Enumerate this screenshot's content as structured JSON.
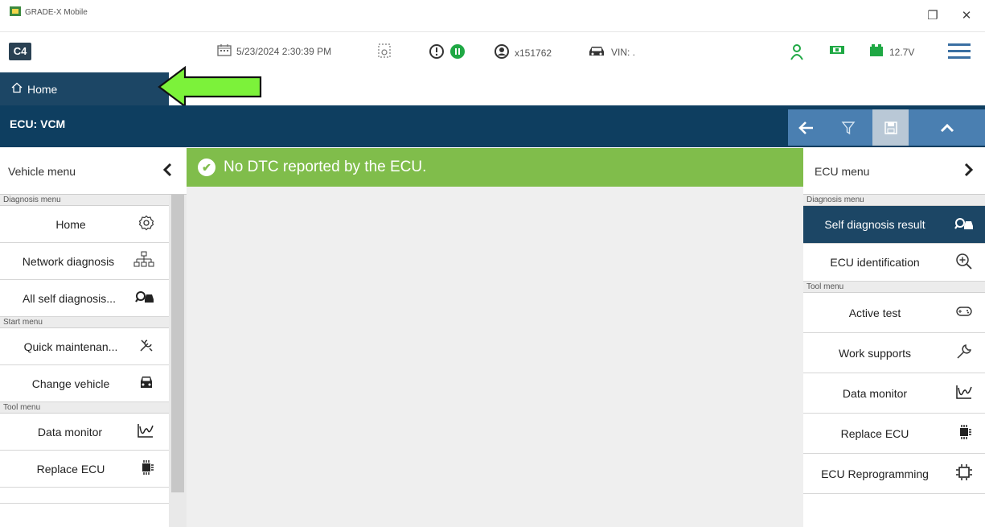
{
  "window": {
    "title": "GRADE-X Mobile",
    "controls": {
      "restore": "❐",
      "close": "✕"
    }
  },
  "toolbar": {
    "logo": "C4",
    "datetime": "5/23/2024 2:30:39 PM",
    "user": "x151762",
    "vin": "VIN: .",
    "voltage": "12.7V"
  },
  "nav": {
    "home_label": "Home"
  },
  "ecu": {
    "title": "ECU: VCM"
  },
  "left_panel": {
    "header": "Vehicle menu",
    "sections": [
      {
        "label": "Diagnosis menu",
        "items": [
          {
            "label": "Home",
            "icon": "gear-icon"
          },
          {
            "label": "Network diagnosis",
            "icon": "network-icon"
          },
          {
            "label": "All self diagnosis...",
            "icon": "car-search-icon"
          }
        ]
      },
      {
        "label": "Start menu",
        "items": [
          {
            "label": "Quick maintenan...",
            "icon": "tools-icon"
          },
          {
            "label": "Change vehicle",
            "icon": "car-front-icon"
          }
        ]
      },
      {
        "label": "Tool menu",
        "items": [
          {
            "label": "Data monitor",
            "icon": "waveform-icon"
          },
          {
            "label": "Replace ECU",
            "icon": "chip-icon"
          }
        ]
      }
    ]
  },
  "main": {
    "banner_text": "No DTC reported by the ECU."
  },
  "right_panel": {
    "header": "ECU menu",
    "diagnosis_label": "Diagnosis menu",
    "diagnosis_items": [
      {
        "label": "Self diagnosis result",
        "icon": "car-search-icon",
        "active": true
      },
      {
        "label": "ECU identification",
        "icon": "zoom-in-icon"
      }
    ],
    "tool_label": "Tool menu",
    "tool_items": [
      {
        "label": "Active test",
        "icon": "gamepad-icon"
      },
      {
        "label": "Work supports",
        "icon": "wrench-icon"
      },
      {
        "label": "Data monitor",
        "icon": "waveform-icon"
      },
      {
        "label": "Replace ECU",
        "icon": "chip-icon"
      },
      {
        "label": "ECU Reprogramming",
        "icon": "chip-outline-icon"
      }
    ]
  },
  "colors": {
    "nav_dark": "#1c4665",
    "ecu_bar": "#0e3e60",
    "tool_blue": "#4a7fb1",
    "banner_green": "#80bd4b",
    "annotation_green": "#7cf23a"
  }
}
